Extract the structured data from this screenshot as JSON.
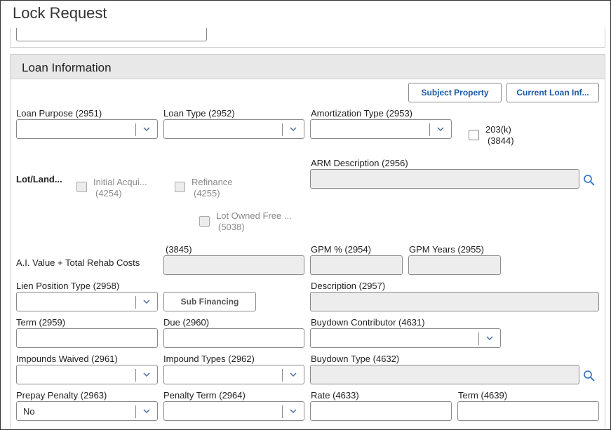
{
  "window": {
    "title": "Lock Request"
  },
  "section": {
    "title": "Loan Information"
  },
  "buttons": {
    "subject_property": "Subject Property",
    "current_loan_info": "Current Loan Inf...",
    "sub_financing": "Sub Financing"
  },
  "fields": {
    "loan_purpose": {
      "label": "Loan Purpose (2951)",
      "value": ""
    },
    "loan_type": {
      "label": "Loan Type (2952)",
      "value": ""
    },
    "amortization_type": {
      "label": "Amortization Type (2953)",
      "value": ""
    },
    "cb_203k": {
      "label": "203(k)",
      "sub": "(3844)",
      "checked": false
    },
    "arm_description": {
      "label": "ARM Description (2956)",
      "value": ""
    },
    "lot_land": {
      "label": "Lot/Land..."
    },
    "initial_acquisition": {
      "label": "Initial Acqui...",
      "sub": "(4254)",
      "checked": false
    },
    "refinance": {
      "label": "Refinance",
      "sub": "(4255)",
      "checked": false
    },
    "lot_owned_free": {
      "label": "Lot Owned Free ...",
      "sub": "(5038)",
      "checked": false
    },
    "ai_value": {
      "label": "A.I. Value + Total Rehab Costs",
      "sub": "(3845)",
      "value": ""
    },
    "gpm_percent": {
      "label": "GPM % (2954)",
      "value": ""
    },
    "gpm_years": {
      "label": "GPM Years (2955)",
      "value": ""
    },
    "lien_position_type": {
      "label": "Lien Position Type (2958)",
      "value": ""
    },
    "description": {
      "label": "Description (2957)",
      "value": ""
    },
    "term": {
      "label": "Term (2959)",
      "value": ""
    },
    "due": {
      "label": "Due (2960)",
      "value": ""
    },
    "buydown_contributor": {
      "label": "Buydown Contributor (4631)",
      "value": ""
    },
    "impounds_waived": {
      "label": "Impounds Waived (2961)",
      "value": ""
    },
    "impound_types": {
      "label": "Impound Types (2962)",
      "value": ""
    },
    "buydown_type": {
      "label": "Buydown Type (4632)",
      "value": ""
    },
    "prepay_penalty": {
      "label": "Prepay Penalty (2963)",
      "value": "No"
    },
    "penalty_term": {
      "label": "Penalty Term (2964)",
      "value": ""
    },
    "rate": {
      "label": "Rate (4633)",
      "value": ""
    },
    "buydown_term": {
      "label": "Term (4639)",
      "value": ""
    }
  },
  "icons": {
    "dropdown": "chevron-down-icon",
    "search": "search-icon"
  },
  "colors": {
    "link_blue": "#1a5aa6",
    "search_blue": "#2a6fc9",
    "disabled_bg": "#ededed",
    "header_bg": "#e8e8e8"
  }
}
